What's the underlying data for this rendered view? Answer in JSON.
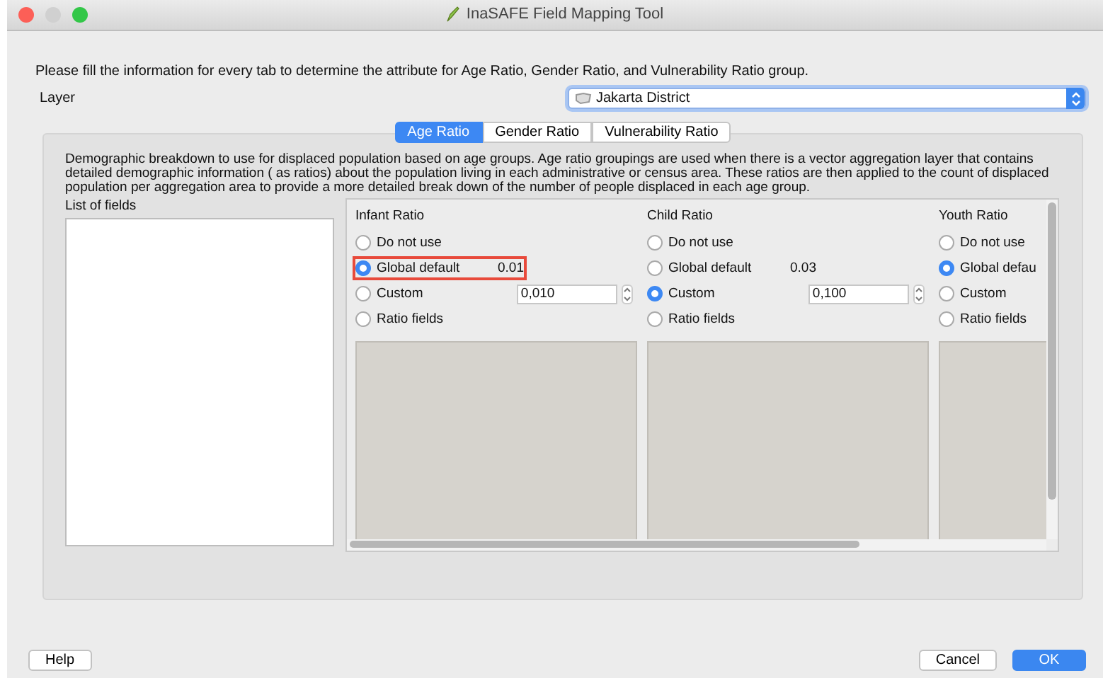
{
  "window": {
    "title": "InaSAFE Field Mapping Tool"
  },
  "instruction": "Please fill the information for every tab to determine the attribute for Age Ratio, Gender Ratio, and Vulnerability Ratio group.",
  "layer": {
    "label": "Layer",
    "value": "Jakarta District"
  },
  "tabs": [
    {
      "label": "Age Ratio",
      "selected": true
    },
    {
      "label": "Gender Ratio",
      "selected": false
    },
    {
      "label": "Vulnerability Ratio",
      "selected": false
    }
  ],
  "description": "Demographic breakdown to use for displaced population based on age groups. Age ratio groupings are used when there is a vector aggregation layer that contains detailed demographic information ( as ratios) about the population living in each administrative or census area. These ratios are then applied to the count of displaced population per aggregation area to provide a more detailed break down of the number of people displaced in each age group.",
  "fields_list": {
    "label": "List of fields"
  },
  "ratios": [
    {
      "title": "Infant Ratio",
      "options": [
        {
          "kind": "plain",
          "label": "Do not use",
          "selected": false
        },
        {
          "kind": "default",
          "label": "Global default",
          "value": "0.01",
          "selected": true,
          "highlighted": true
        },
        {
          "kind": "custom",
          "label": "Custom",
          "value": "0,010",
          "selected": false
        },
        {
          "kind": "plain",
          "label": "Ratio fields",
          "selected": false
        }
      ]
    },
    {
      "title": "Child Ratio",
      "options": [
        {
          "kind": "plain",
          "label": "Do not use",
          "selected": false
        },
        {
          "kind": "default",
          "label": "Global default",
          "value": "0.03",
          "selected": false,
          "highlighted": false
        },
        {
          "kind": "custom",
          "label": "Custom",
          "value": "0,100",
          "selected": true
        },
        {
          "kind": "plain",
          "label": "Ratio fields",
          "selected": false
        }
      ]
    },
    {
      "title": "Youth Ratio",
      "options": [
        {
          "kind": "plain",
          "label": "Do not use",
          "selected": false
        },
        {
          "kind": "plain",
          "label": "Global defau",
          "selected": true
        },
        {
          "kind": "plain",
          "label": "Custom",
          "selected": false
        },
        {
          "kind": "plain",
          "label": "Ratio fields",
          "selected": false
        }
      ]
    }
  ],
  "buttons": {
    "help": "Help",
    "cancel": "Cancel",
    "ok": "OK"
  }
}
